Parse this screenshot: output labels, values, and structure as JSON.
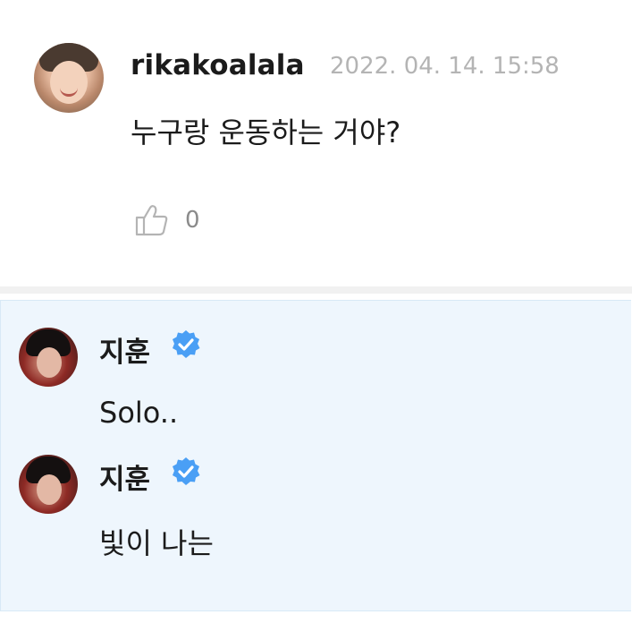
{
  "comment": {
    "username": "rikakoalala",
    "timestamp": "2022. 04. 14. 15:58",
    "text": "누구랑 운동하는 거야?",
    "like_count": "0",
    "icons": {
      "like": "thumbs-up-icon"
    }
  },
  "replies": [
    {
      "name": "지훈",
      "text": "Solo..",
      "verified_icon": "verified-badge-icon"
    },
    {
      "name": "지훈",
      "text": "빛이 나는",
      "verified_icon": "verified-badge-icon"
    }
  ],
  "colors": {
    "reply_background": "#eef6fd",
    "verified_blue": "#4a9ff5",
    "timestamp_gray": "#b4b4b4"
  }
}
